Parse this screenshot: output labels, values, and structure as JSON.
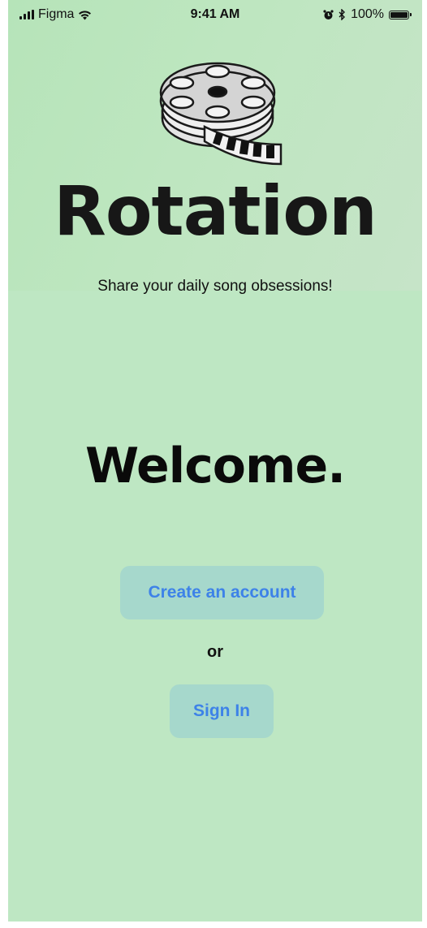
{
  "status_bar": {
    "carrier": "Figma",
    "time": "9:41 AM",
    "battery": "100%"
  },
  "app": {
    "title": "Rotation",
    "tagline": "Share your daily song obsessions!"
  },
  "welcome": {
    "heading": "Welcome.",
    "create_label": "Create an account",
    "or_label": "or",
    "signin_label": "Sign In"
  },
  "colors": {
    "background": "#bee7c3",
    "button_bg": "#a6d8cc",
    "button_text": "#3d82e8"
  }
}
